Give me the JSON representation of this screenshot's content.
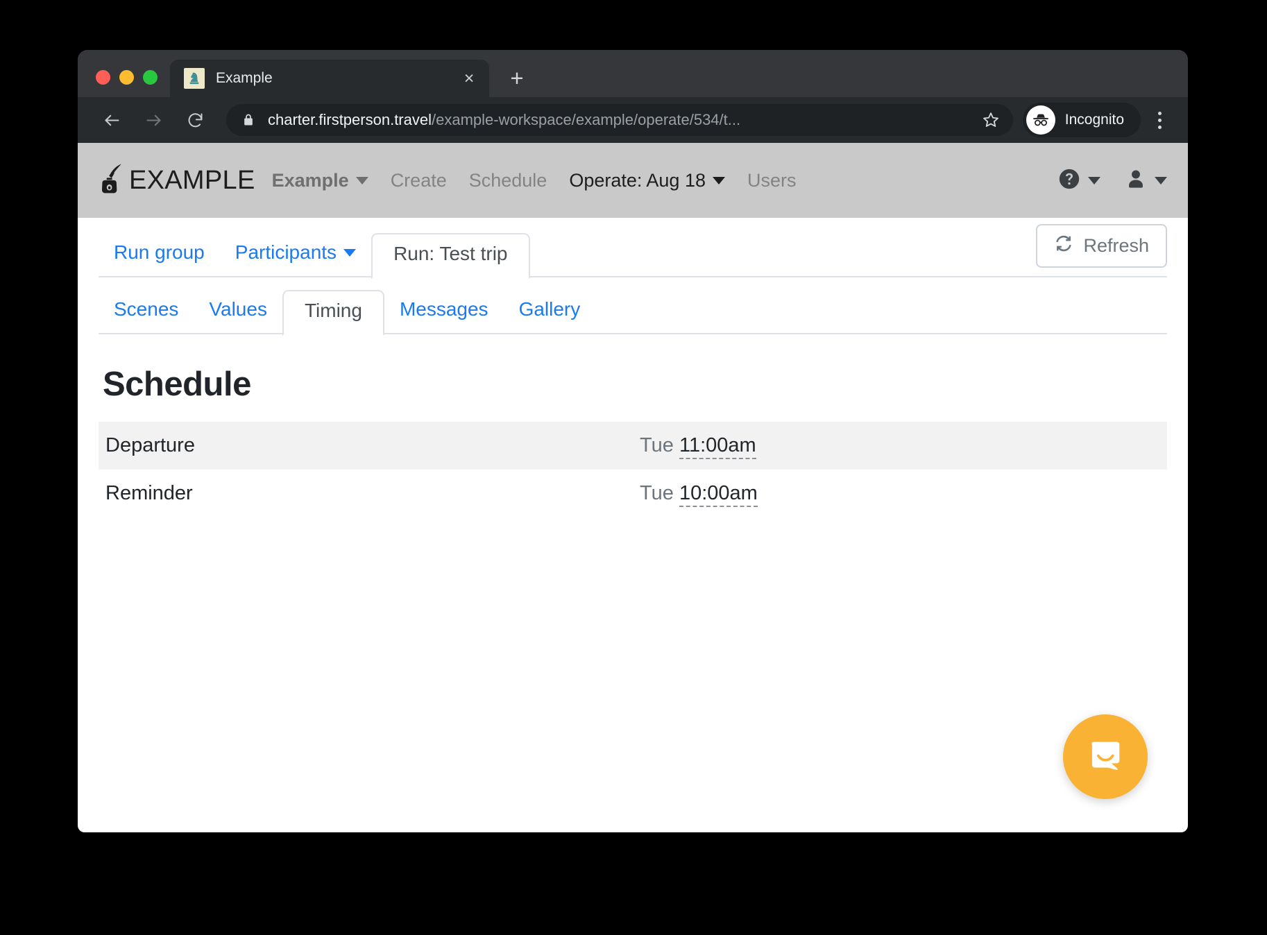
{
  "browser": {
    "tab": {
      "title": "Example",
      "favicon_icon": "chess-knight-icon",
      "close_icon": "×"
    },
    "new_tab_label": "+",
    "back_icon": "arrow-left-icon",
    "forward_icon": "arrow-right-icon",
    "reload_icon": "reload-icon",
    "lock_icon": "lock-icon",
    "url_host": "charter.firstperson.travel",
    "url_path": "/example-workspace/example/operate/534/t...",
    "star_icon": "star-icon",
    "incognito_label": "Incognito",
    "menu_icon": "kebab-menu-icon"
  },
  "appnav": {
    "brand": "EXAMPLE",
    "brand_icon": "inkwell-quill-icon",
    "workspace": "Example",
    "links": [
      {
        "label": "Create"
      },
      {
        "label": "Schedule"
      },
      {
        "label": "Operate: Aug 18"
      },
      {
        "label": "Users"
      }
    ],
    "help_icon": "help-circle-icon",
    "account_icon": "user-icon"
  },
  "primary_tabs": [
    {
      "label": "Run group",
      "active": false,
      "dropdown": false
    },
    {
      "label": "Participants",
      "active": false,
      "dropdown": true
    },
    {
      "label": "Run: Test trip",
      "active": true,
      "dropdown": false
    }
  ],
  "toolbar": {
    "refresh_label": "Refresh",
    "refresh_icon": "refresh-icon"
  },
  "sub_tabs": [
    {
      "label": "Scenes",
      "active": false
    },
    {
      "label": "Values",
      "active": false
    },
    {
      "label": "Timing",
      "active": true
    },
    {
      "label": "Messages",
      "active": false
    },
    {
      "label": "Gallery",
      "active": false
    }
  ],
  "schedule": {
    "title": "Schedule",
    "rows": [
      {
        "label": "Departure",
        "day": "Tue",
        "time": "11:00am"
      },
      {
        "label": "Reminder",
        "day": "Tue",
        "time": "10:00am"
      }
    ]
  },
  "intercom": {
    "icon": "chat-bubble-icon",
    "color": "#f9b233"
  },
  "colors": {
    "link_blue": "#1a7bf0",
    "navbar_bg": "#c9c9c9",
    "chrome_dark": "#282b2e",
    "row_stripe": "#f2f2f2"
  }
}
